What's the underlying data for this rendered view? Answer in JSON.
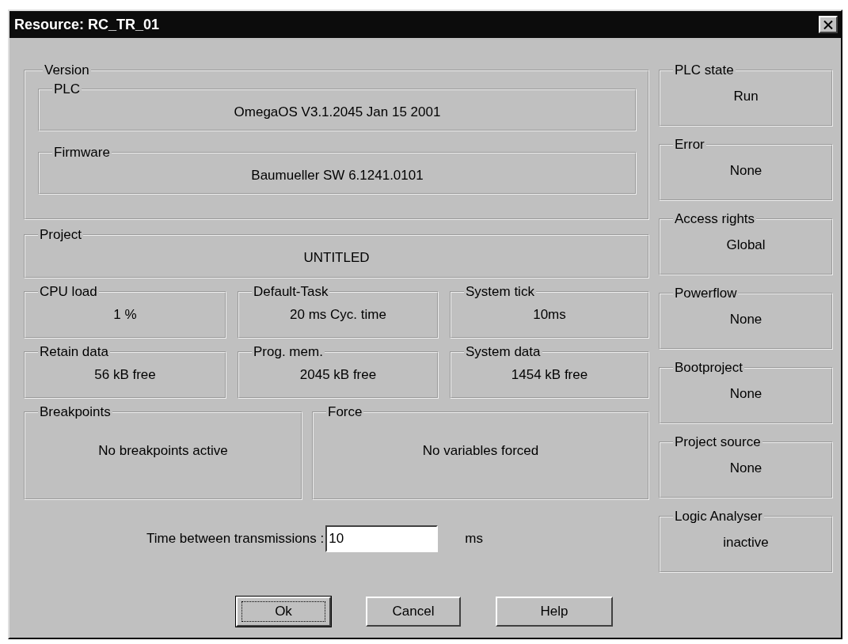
{
  "window": {
    "title": "Resource: RC_TR_01"
  },
  "version": {
    "label": "Version",
    "groups": [
      {
        "label": "PLC",
        "value": "OmegaOS V3.1.2045 Jan 15 2001"
      },
      {
        "label": "Firmware",
        "value": "Baumueller SW 6.1241.0101"
      }
    ]
  },
  "project": {
    "label": "Project",
    "value": "UNTITLED"
  },
  "stats": [
    {
      "label": "CPU load",
      "value": "1 %"
    },
    {
      "label": "Default-Task",
      "value": "20 ms Cyc. time"
    },
    {
      "label": "System tick",
      "value": "10ms"
    },
    {
      "label": "Retain data",
      "value": "56 kB free"
    },
    {
      "label": "Prog. mem.",
      "value": "2045 kB free"
    },
    {
      "label": "System data",
      "value": "1454 kB free"
    }
  ],
  "wide": [
    {
      "label": "Breakpoints",
      "value": "No breakpoints active"
    },
    {
      "label": "Force",
      "value": "No variables forced"
    }
  ],
  "status": [
    {
      "label": "PLC state",
      "value": "Run"
    },
    {
      "label": "Error",
      "value": "None"
    },
    {
      "label": "Access rights",
      "value": "Global"
    },
    {
      "label": "Powerflow",
      "value": "None"
    },
    {
      "label": "Bootproject",
      "value": "None"
    },
    {
      "label": "Project source",
      "value": "None"
    },
    {
      "label": "Logic Analyser",
      "value": "inactive"
    }
  ],
  "transmission": {
    "label": "Time between transmissions :",
    "value": "10",
    "unit": "ms"
  },
  "buttons": [
    {
      "label": "Ok",
      "default": true
    },
    {
      "label": "Cancel",
      "default": false
    },
    {
      "label": "Help",
      "default": false
    }
  ]
}
